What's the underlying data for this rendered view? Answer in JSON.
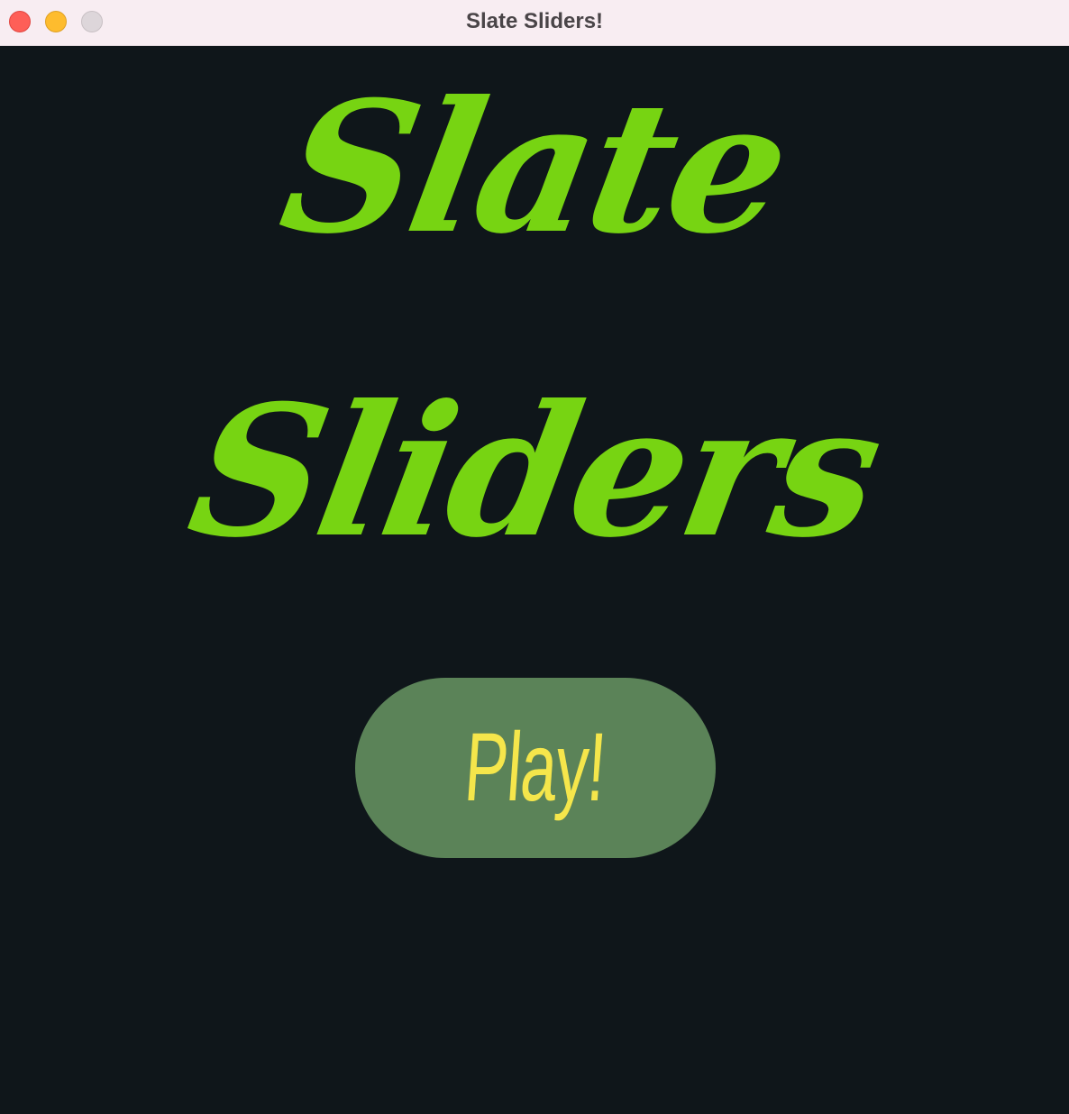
{
  "window": {
    "title": "Slate Sliders!",
    "controls": [
      "close",
      "minimize",
      "zoom"
    ]
  },
  "menu": {
    "logo_line1": "Slate",
    "logo_line2": "Sliders",
    "play_label": "Play!"
  },
  "colors": {
    "background": "#0f161a",
    "logo": "#77d412",
    "play_button": "#5b8358",
    "play_text": "#f5e64b"
  }
}
